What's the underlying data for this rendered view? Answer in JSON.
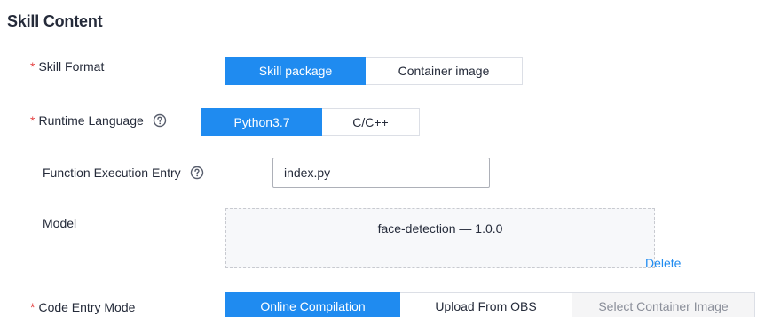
{
  "section": {
    "title": "Skill Content"
  },
  "skill_format": {
    "label": "Skill Format",
    "required_mark": "*",
    "options": [
      "Skill package",
      "Container image"
    ],
    "selected": "Skill package"
  },
  "runtime_language": {
    "label": "Runtime Language",
    "required_mark": "*",
    "help_icon": "question-circle-icon",
    "options": [
      "Python3.7",
      "C/C++"
    ],
    "selected": "Python3.7"
  },
  "function_entry": {
    "label": "Function Execution Entry",
    "help_icon": "question-circle-icon",
    "value": "index.py"
  },
  "model": {
    "label": "Model",
    "item": "face-detection — 1.0.0",
    "delete_label": "Delete"
  },
  "code_entry_mode": {
    "label": "Code Entry Mode",
    "required_mark": "*",
    "options": [
      "Online Compilation",
      "Upload From OBS",
      "Select Container Image"
    ],
    "selected": "Online Compilation",
    "disabled": [
      "Select Container Image"
    ]
  },
  "colors": {
    "accent": "#1f8bf0",
    "required": "#e54545",
    "text": "#252b3a",
    "disabled_bg": "#f5f5f6"
  }
}
